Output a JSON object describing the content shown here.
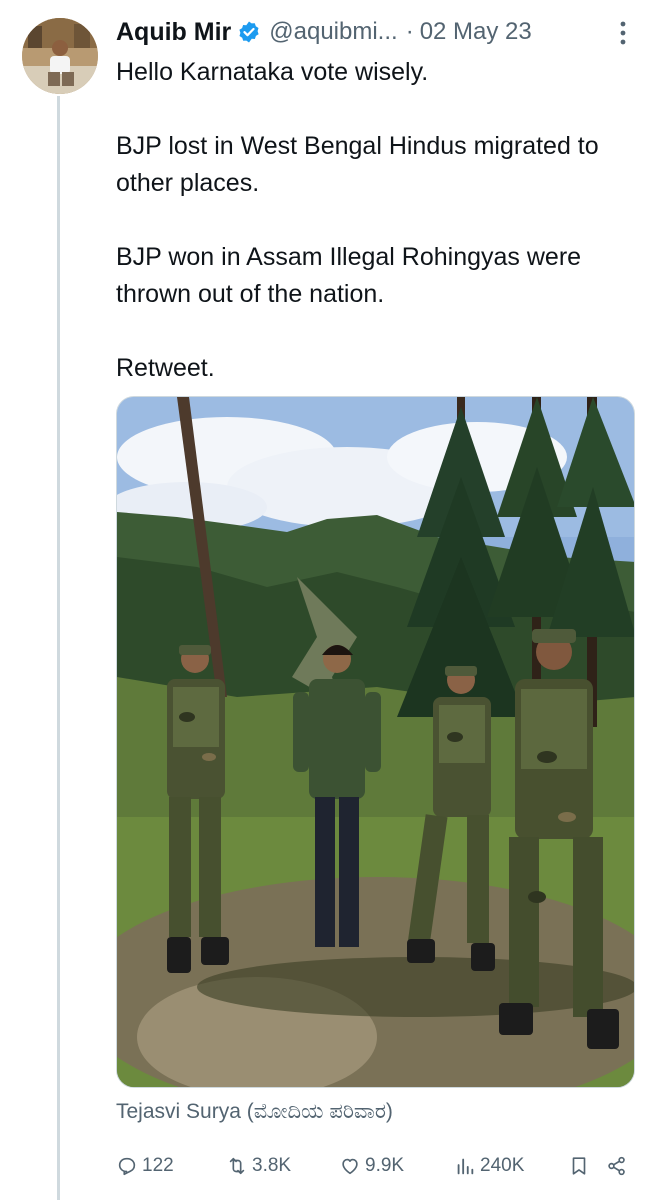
{
  "tweet": {
    "author": {
      "display_name": "Aquib Mir",
      "handle": "@aquibmi...",
      "verified": true,
      "avatar_icon": "profile-photo"
    },
    "separator": "·",
    "date": "02 May 23",
    "text": [
      "Hello Karnataka vote wisely.",
      "BJP lost in West Bengal Hindus migrated to other places.",
      "BJP won in Assam Illegal Rohingyas were thrown out of the nation.",
      "Retweet."
    ],
    "media": {
      "type": "photo",
      "description_icon": "photo-of-soldiers-in-forest"
    },
    "attribution": "Tejasvi Surya (ಮೋದಿಯ ಪರಿವಾರ)",
    "metrics": {
      "replies": "122",
      "retweets": "3.8K",
      "likes": "9.9K",
      "views": "240K"
    }
  },
  "colors": {
    "text_primary": "#0f1419",
    "text_secondary": "#536471",
    "verified_blue": "#1d9bf0",
    "thread_line": "#cfd9de"
  }
}
